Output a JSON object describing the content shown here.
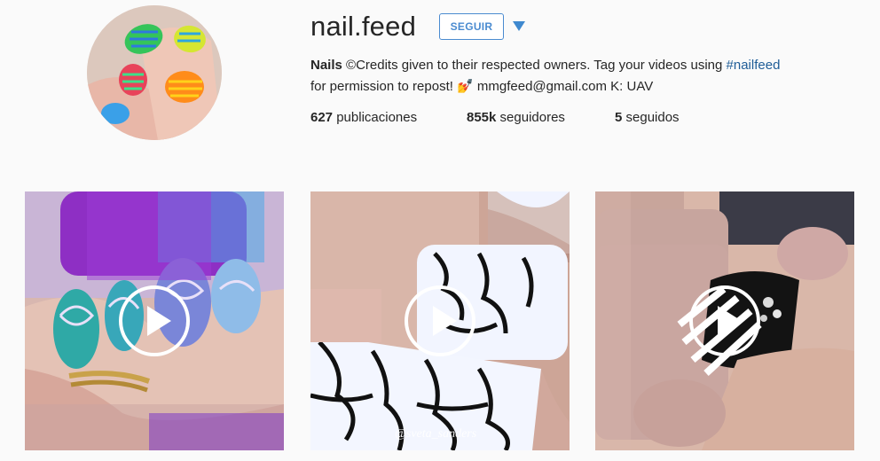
{
  "profile": {
    "username": "nail.feed",
    "follow_label": "SEGUIR",
    "bio": {
      "name": "Nails",
      "text_1": " ©Credits given to their respected owners. Tag your videos using ",
      "hashtag": "#nailfeed",
      "text_2": "for permission to repost! 💅 mmgfeed@gmail.com K: UAV"
    },
    "stats": {
      "posts_count": "627",
      "posts_label": "publicaciones",
      "followers_count": "855k",
      "followers_label": "seguidores",
      "following_count": "5",
      "following_label": "seguidos"
    }
  },
  "posts": [
    {
      "type": "video",
      "icon": "play-icon"
    },
    {
      "type": "video",
      "icon": "play-icon",
      "watermark": "@sveta_sanders"
    },
    {
      "type": "video",
      "icon": "play-icon"
    }
  ],
  "colors": {
    "accent": "#4a8bd0",
    "hashtag": "#1f5d97",
    "background": "#fafafa"
  }
}
